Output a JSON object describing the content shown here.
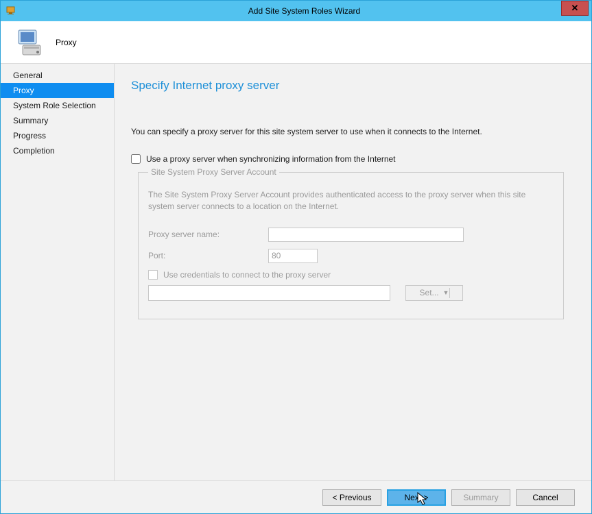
{
  "titlebar": {
    "title": "Add Site System Roles Wizard"
  },
  "header": {
    "step": "Proxy"
  },
  "sidebar": {
    "items": [
      {
        "label": "General"
      },
      {
        "label": "Proxy",
        "active": true
      },
      {
        "label": "System Role Selection"
      },
      {
        "label": "Summary"
      },
      {
        "label": "Progress"
      },
      {
        "label": "Completion"
      }
    ]
  },
  "content": {
    "page_title": "Specify Internet proxy server",
    "description": "You can specify a proxy server for this site system server to use when it connects to the Internet.",
    "use_proxy_label": "Use a proxy server when synchronizing information from the Internet",
    "fieldset": {
      "legend": "Site System Proxy Server Account",
      "desc": "The Site System Proxy Server Account provides authenticated access to the proxy server when this site system server connects to a location on the Internet.",
      "proxy_name_label": "Proxy server name:",
      "proxy_name_value": "",
      "port_label": "Port:",
      "port_value": "80",
      "use_creds_label": "Use credentials to connect to the proxy server",
      "cred_value": "",
      "set_label": "Set..."
    }
  },
  "footer": {
    "previous": "< Previous",
    "next": "Next >",
    "summary": "Summary",
    "cancel": "Cancel"
  }
}
